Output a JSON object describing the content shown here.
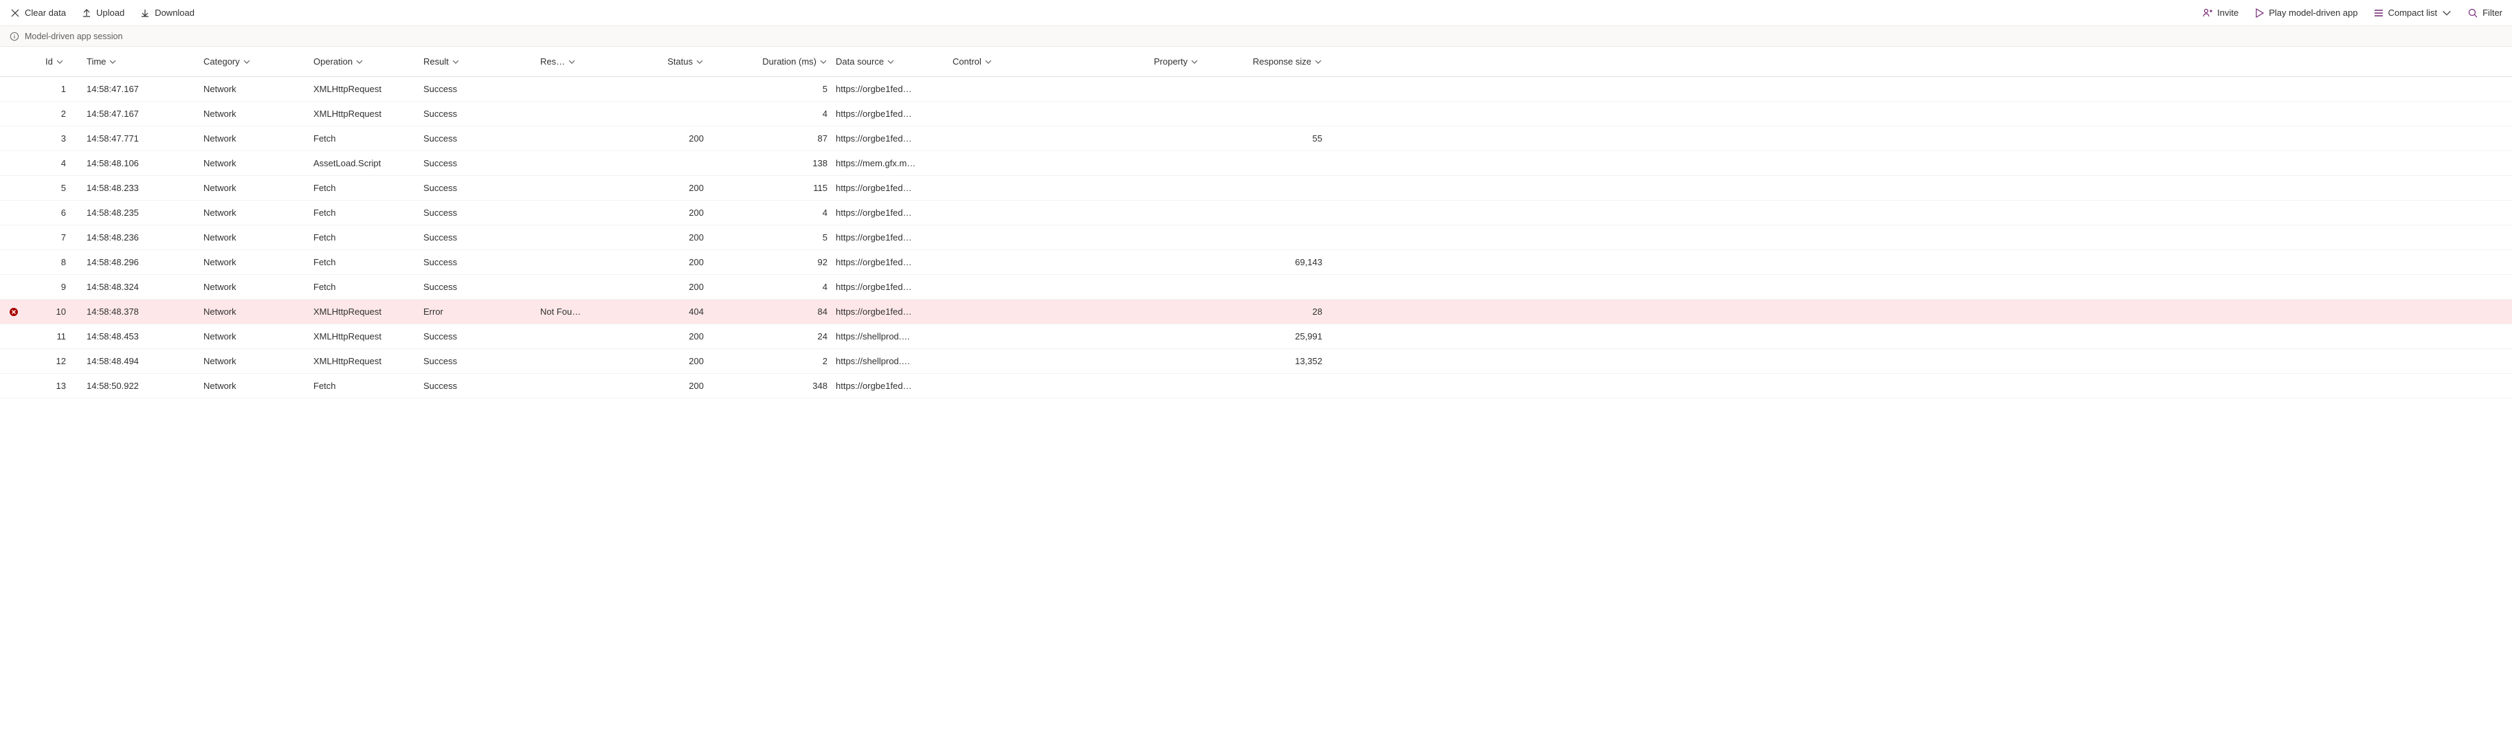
{
  "toolbar": {
    "clear_data": "Clear data",
    "upload": "Upload",
    "download": "Download",
    "invite": "Invite",
    "play": "Play model-driven app",
    "view_mode": "Compact list",
    "filter": "Filter"
  },
  "session_bar": "Model-driven app session",
  "columns": {
    "id": "Id",
    "time": "Time",
    "category": "Category",
    "operation": "Operation",
    "result": "Result",
    "result_reason": "Res…",
    "status": "Status",
    "duration": "Duration (ms)",
    "data_source": "Data source",
    "control": "Control",
    "property": "Property",
    "response_size": "Response size"
  },
  "rows": [
    {
      "id": "1",
      "time": "14:58:47.167",
      "category": "Network",
      "operation": "XMLHttpRequest",
      "result": "Success",
      "reason": "",
      "status": "",
      "duration": "5",
      "data_source": "https://orgbe1fed…",
      "control": "",
      "property": "",
      "resp": "",
      "err": false
    },
    {
      "id": "2",
      "time": "14:58:47.167",
      "category": "Network",
      "operation": "XMLHttpRequest",
      "result": "Success",
      "reason": "",
      "status": "",
      "duration": "4",
      "data_source": "https://orgbe1fed…",
      "control": "",
      "property": "",
      "resp": "",
      "err": false
    },
    {
      "id": "3",
      "time": "14:58:47.771",
      "category": "Network",
      "operation": "Fetch",
      "result": "Success",
      "reason": "",
      "status": "200",
      "duration": "87",
      "data_source": "https://orgbe1fed…",
      "control": "",
      "property": "",
      "resp": "55",
      "err": false
    },
    {
      "id": "4",
      "time": "14:58:48.106",
      "category": "Network",
      "operation": "AssetLoad.Script",
      "result": "Success",
      "reason": "",
      "status": "",
      "duration": "138",
      "data_source": "https://mem.gfx.m…",
      "control": "",
      "property": "",
      "resp": "",
      "err": false
    },
    {
      "id": "5",
      "time": "14:58:48.233",
      "category": "Network",
      "operation": "Fetch",
      "result": "Success",
      "reason": "",
      "status": "200",
      "duration": "115",
      "data_source": "https://orgbe1fed…",
      "control": "",
      "property": "",
      "resp": "",
      "err": false
    },
    {
      "id": "6",
      "time": "14:58:48.235",
      "category": "Network",
      "operation": "Fetch",
      "result": "Success",
      "reason": "",
      "status": "200",
      "duration": "4",
      "data_source": "https://orgbe1fed…",
      "control": "",
      "property": "",
      "resp": "",
      "err": false
    },
    {
      "id": "7",
      "time": "14:58:48.236",
      "category": "Network",
      "operation": "Fetch",
      "result": "Success",
      "reason": "",
      "status": "200",
      "duration": "5",
      "data_source": "https://orgbe1fed…",
      "control": "",
      "property": "",
      "resp": "",
      "err": false
    },
    {
      "id": "8",
      "time": "14:58:48.296",
      "category": "Network",
      "operation": "Fetch",
      "result": "Success",
      "reason": "",
      "status": "200",
      "duration": "92",
      "data_source": "https://orgbe1fed…",
      "control": "",
      "property": "",
      "resp": "69,143",
      "err": false
    },
    {
      "id": "9",
      "time": "14:58:48.324",
      "category": "Network",
      "operation": "Fetch",
      "result": "Success",
      "reason": "",
      "status": "200",
      "duration": "4",
      "data_source": "https://orgbe1fed…",
      "control": "",
      "property": "",
      "resp": "",
      "err": false
    },
    {
      "id": "10",
      "time": "14:58:48.378",
      "category": "Network",
      "operation": "XMLHttpRequest",
      "result": "Error",
      "reason": "Not Fou…",
      "status": "404",
      "duration": "84",
      "data_source": "https://orgbe1fed…",
      "control": "",
      "property": "",
      "resp": "28",
      "err": true
    },
    {
      "id": "11",
      "time": "14:58:48.453",
      "category": "Network",
      "operation": "XMLHttpRequest",
      "result": "Success",
      "reason": "",
      "status": "200",
      "duration": "24",
      "data_source": "https://shellprod.…",
      "control": "",
      "property": "",
      "resp": "25,991",
      "err": false
    },
    {
      "id": "12",
      "time": "14:58:48.494",
      "category": "Network",
      "operation": "XMLHttpRequest",
      "result": "Success",
      "reason": "",
      "status": "200",
      "duration": "2",
      "data_source": "https://shellprod.…",
      "control": "",
      "property": "",
      "resp": "13,352",
      "err": false
    },
    {
      "id": "13",
      "time": "14:58:50.922",
      "category": "Network",
      "operation": "Fetch",
      "result": "Success",
      "reason": "",
      "status": "200",
      "duration": "348",
      "data_source": "https://orgbe1fed…",
      "control": "",
      "property": "",
      "resp": "",
      "err": false
    }
  ]
}
